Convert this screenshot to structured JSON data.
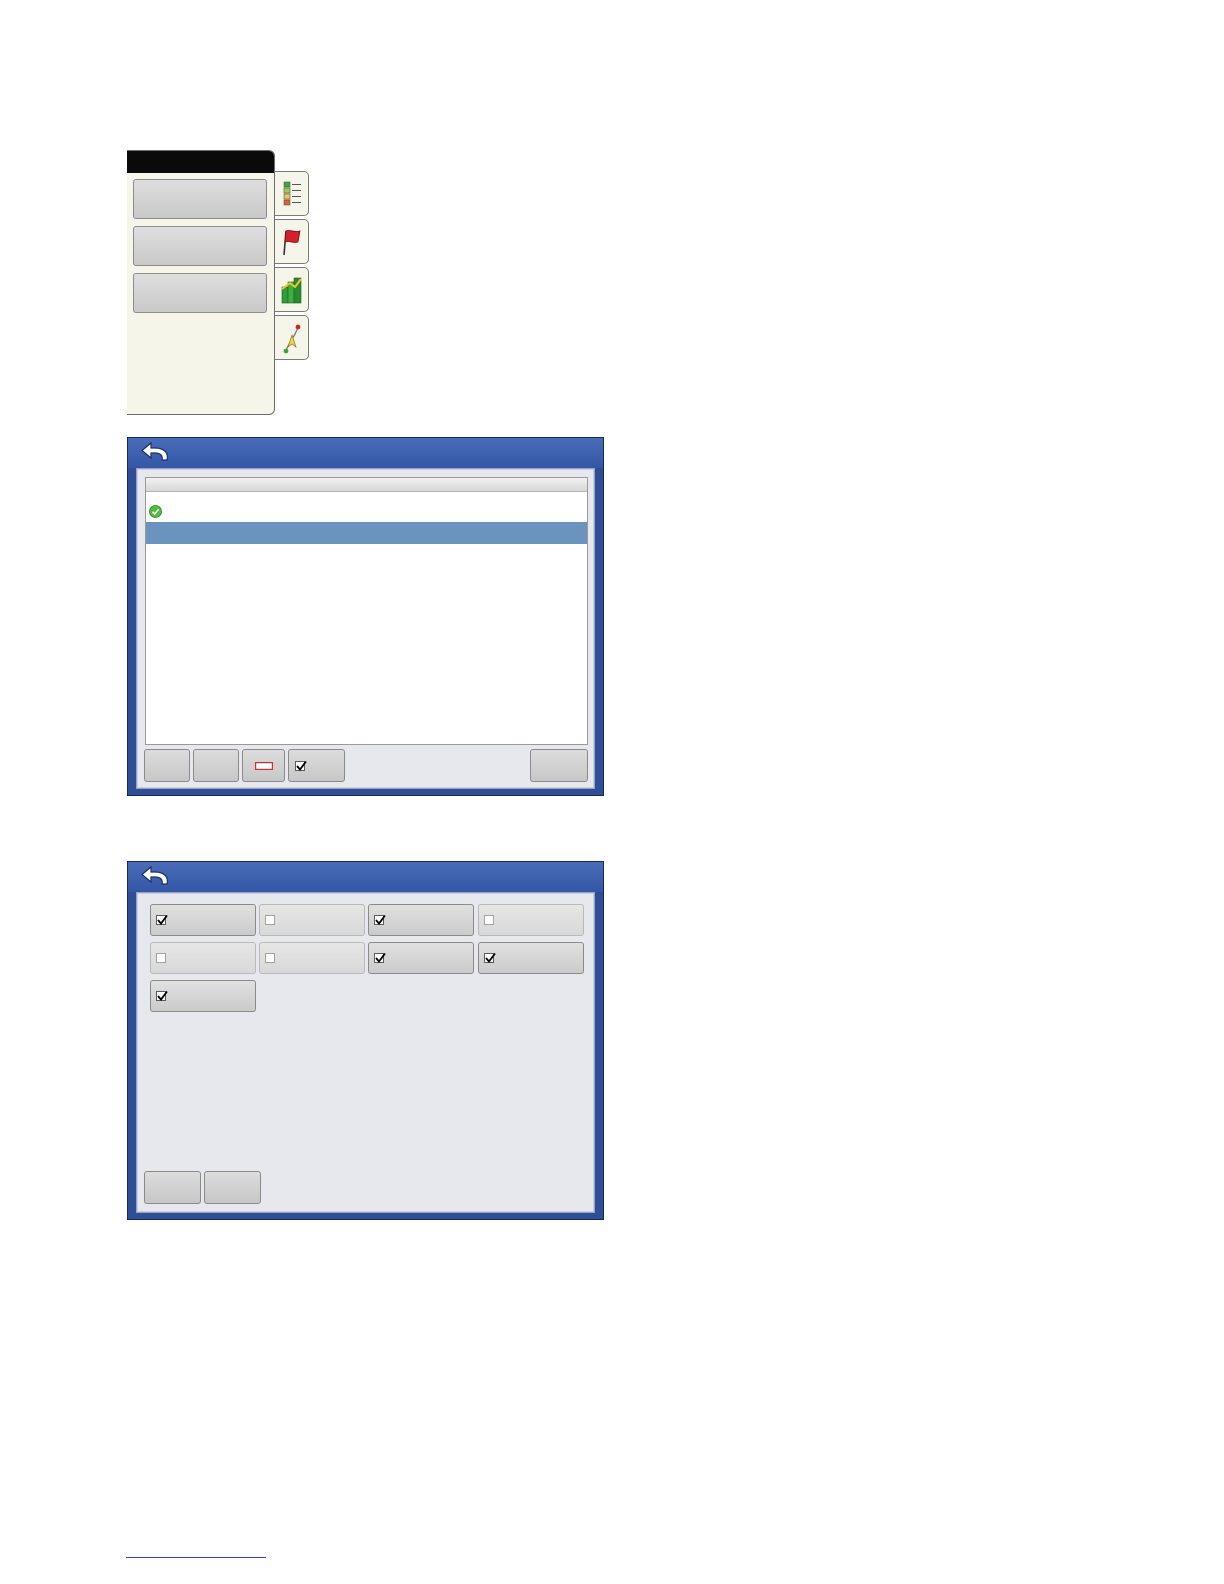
{
  "menu": {
    "header": "",
    "buttons": [
      "",
      "",
      ""
    ]
  },
  "side_tabs": [
    {
      "icon": "stacked-levels-icon"
    },
    {
      "icon": "red-flag-icon"
    },
    {
      "icon": "bar-chart-icon"
    },
    {
      "icon": "guidance-path-icon"
    }
  ],
  "list_window": {
    "title": "",
    "column_header": "",
    "rows": [
      {
        "label": "",
        "status": "active",
        "selected": false
      },
      {
        "label": "",
        "status": "",
        "selected": true
      }
    ],
    "toolbar": {
      "btn1": "",
      "btn2": "",
      "remove_btn": "",
      "check_btn": "",
      "right_btn": ""
    },
    "colors": {
      "selected_row": "#6a93bd",
      "frame": "#2e4e95",
      "remove": "#d32a2a"
    }
  },
  "grid_window": {
    "title": "",
    "options": [
      {
        "label": "",
        "checked": true,
        "enabled": true
      },
      {
        "label": "",
        "checked": false,
        "enabled": false
      },
      {
        "label": "",
        "checked": true,
        "enabled": true
      },
      {
        "label": "",
        "checked": false,
        "enabled": false
      },
      {
        "label": "",
        "checked": false,
        "enabled": false
      },
      {
        "label": "",
        "checked": false,
        "enabled": false
      },
      {
        "label": "",
        "checked": true,
        "enabled": true
      },
      {
        "label": "",
        "checked": true,
        "enabled": true
      },
      {
        "label": "",
        "checked": true,
        "enabled": true
      }
    ],
    "bottom_buttons": [
      "",
      ""
    ]
  }
}
